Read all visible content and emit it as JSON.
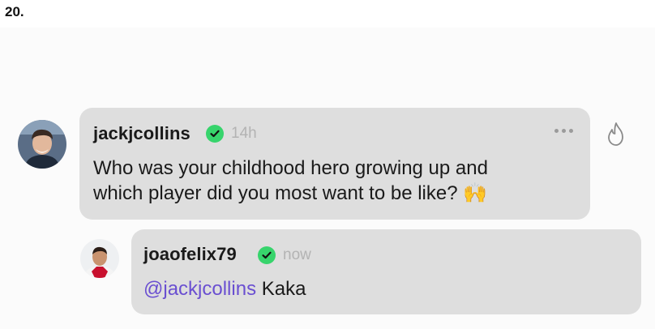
{
  "item_number": "20.",
  "comment": {
    "username": "jackjcollins",
    "time": "14h",
    "line1": "Who was your childhood hero growing up and",
    "line2": "which player did you most want to be like?",
    "emoji": "🙌"
  },
  "reply": {
    "username": "joaofelix79",
    "time": "now",
    "mention": "@jackjcollins",
    "text": " Kaka"
  },
  "icons": {
    "verified": "checkmark-badge-icon",
    "more": "more-horizontal-icon",
    "like": "fire-icon"
  },
  "colors": {
    "verified_green": "#37d46c",
    "mention_purple": "#6a4fd1",
    "bubble_gray": "#dedede"
  }
}
